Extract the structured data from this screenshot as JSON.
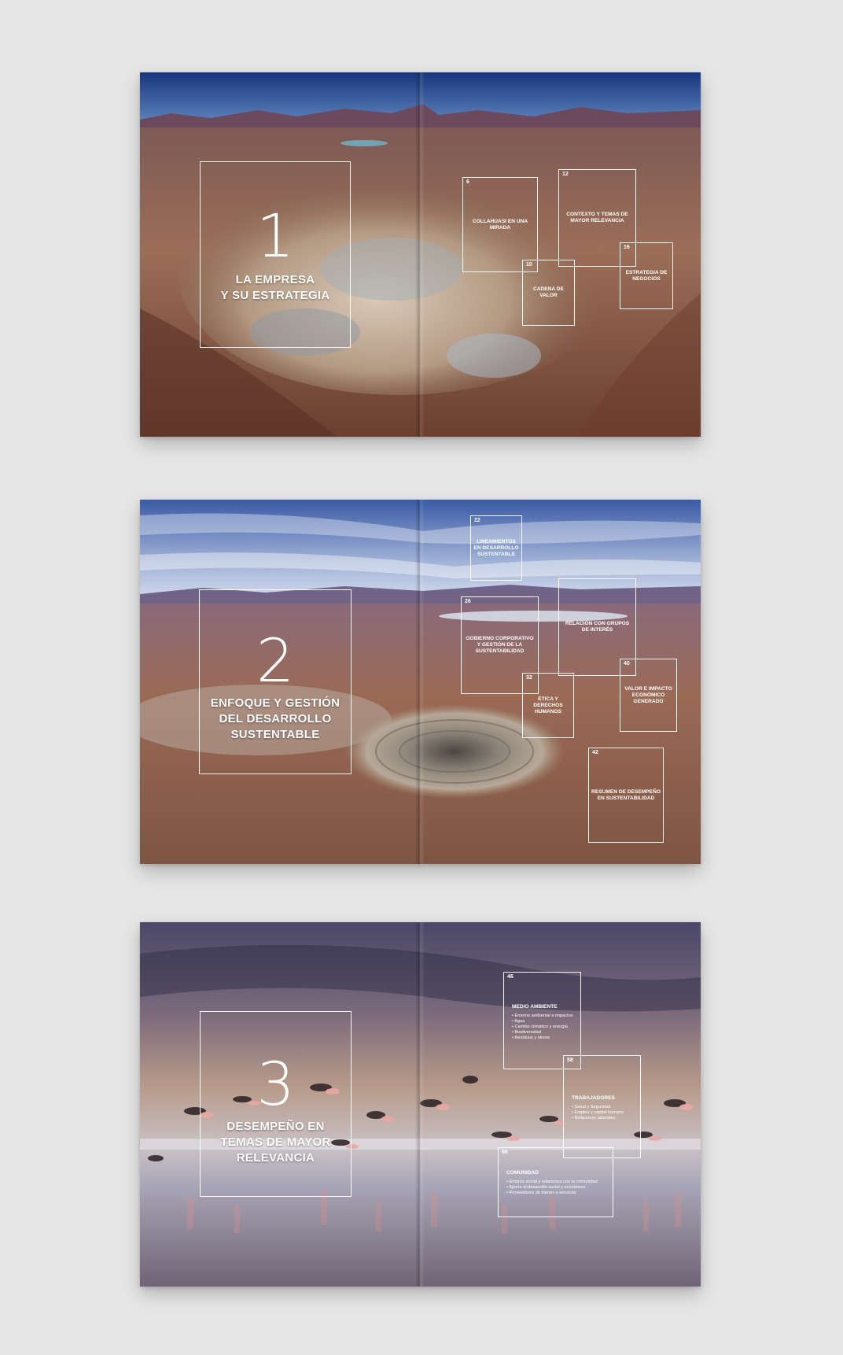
{
  "spreads": [
    {
      "chapter": {
        "number": "1",
        "title_line1": "LA EMPRESA",
        "title_line2": "Y SU ESTRATEGIA"
      },
      "sections": [
        {
          "page": "6",
          "label": "COLLAHUASI EN UNA MIRADA"
        },
        {
          "page": "12",
          "label": "CONTEXTO Y TEMAS DE MAYOR RELEVANCIA"
        },
        {
          "page": "10",
          "label": "CADENA DE VALOR"
        },
        {
          "page": "16",
          "label": "ESTRATEGIA DE NEGOCIOS"
        }
      ]
    },
    {
      "chapter": {
        "number": "2",
        "title_line1": "ENFOQUE Y GESTIÓN",
        "title_line2": "DEL DESARROLLO",
        "title_line3": "SUSTENTABLE"
      },
      "sections": [
        {
          "page": "22",
          "label": "LINEAMIENTOS EN DESARROLLO SUSTENTABLE"
        },
        {
          "page": "26",
          "label": "GOBIERNO CORPORATIVO Y GESTIÓN DE LA SUSTENTABILIDAD"
        },
        {
          "page": "",
          "label": "RELACIÓN CON GRUPOS DE INTERÉS"
        },
        {
          "page": "32",
          "label": "ÉTICA Y DERECHOS HUMANOS"
        },
        {
          "page": "40",
          "label": "VALOR E IMPACTO ECONÓMICO GENERADO"
        },
        {
          "page": "42",
          "label": "RESUMEN DE DESEMPEÑO EN SUSTENTABILIDAD"
        }
      ]
    },
    {
      "chapter": {
        "number": "3",
        "title_line1": "DESEMPEÑO EN",
        "title_line2": "TEMAS DE MAYOR",
        "title_line3": "RELEVANCIA"
      },
      "sections": [
        {
          "page": "46",
          "heading": "MEDIO AMBIENTE",
          "items": [
            "Entorno ambiental e impactos",
            "Agua",
            "Cambio climático y energía",
            "Biodiversidad",
            "Residuos y olores"
          ]
        },
        {
          "page": "58",
          "heading": "TRABAJADORES",
          "items": [
            "Salud y Seguridad",
            "Empleo y capital humano",
            "Relaciones laborales"
          ]
        },
        {
          "page": "66",
          "heading": "COMUNIDAD",
          "items": [
            "Entorno social y relaciones con la comunidad",
            "Aporte al desarrollo social y económico",
            "Proveedores de bienes y servicios"
          ]
        }
      ]
    }
  ],
  "colors": {
    "sky": "#1f3f88",
    "desert": "#8b5a44",
    "lagoon": "#b9a8b2",
    "flamingo": "#e8a0a0"
  }
}
